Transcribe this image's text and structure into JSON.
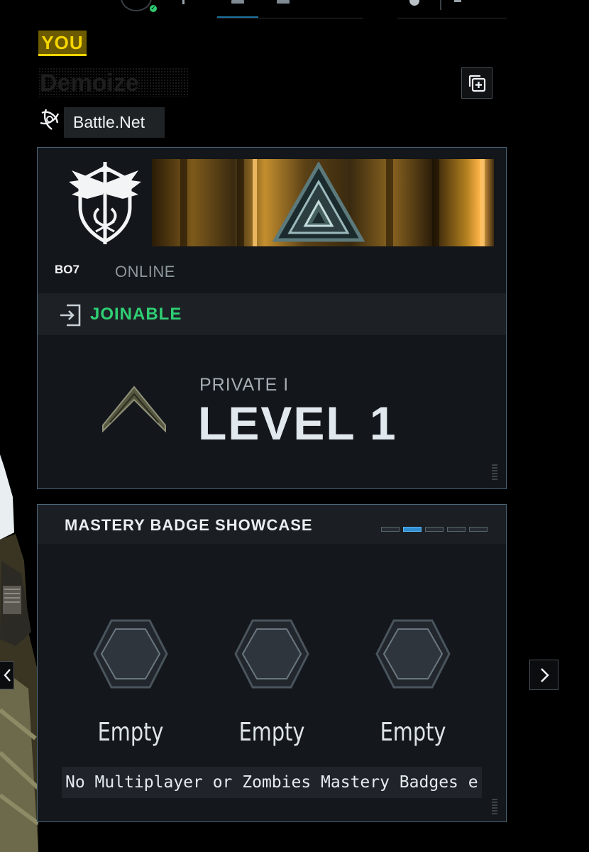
{
  "player": {
    "you_label": "YOU",
    "gamertag": "Demoize",
    "platform": "Battle.Net"
  },
  "profile_card": {
    "game_logo": "BO7",
    "status": "ONLINE",
    "join_status": "JOINABLE",
    "rank_name": "PRIVATE I",
    "level": "LEVEL 1"
  },
  "mastery": {
    "title": "MASTERY BADGE SHOWCASE",
    "page_count": 5,
    "active_page": 2,
    "slots": [
      {
        "label": "Empty"
      },
      {
        "label": "Empty"
      },
      {
        "label": "Empty"
      }
    ],
    "note": "No Multiplayer or Zombies Mastery Badges e"
  },
  "icons": {
    "platform_icon": "battlenet-icon",
    "add_icon": "add-friend-icon",
    "join_icon": "join-icon",
    "next_icon": "chevron-right-icon",
    "prev_icon": "chevron-left-icon"
  },
  "colors": {
    "you_yellow": "#f5d400",
    "joinable_green": "#2fcf73",
    "card_border": "#4d6677",
    "pager_active": "#2f8fd0"
  }
}
